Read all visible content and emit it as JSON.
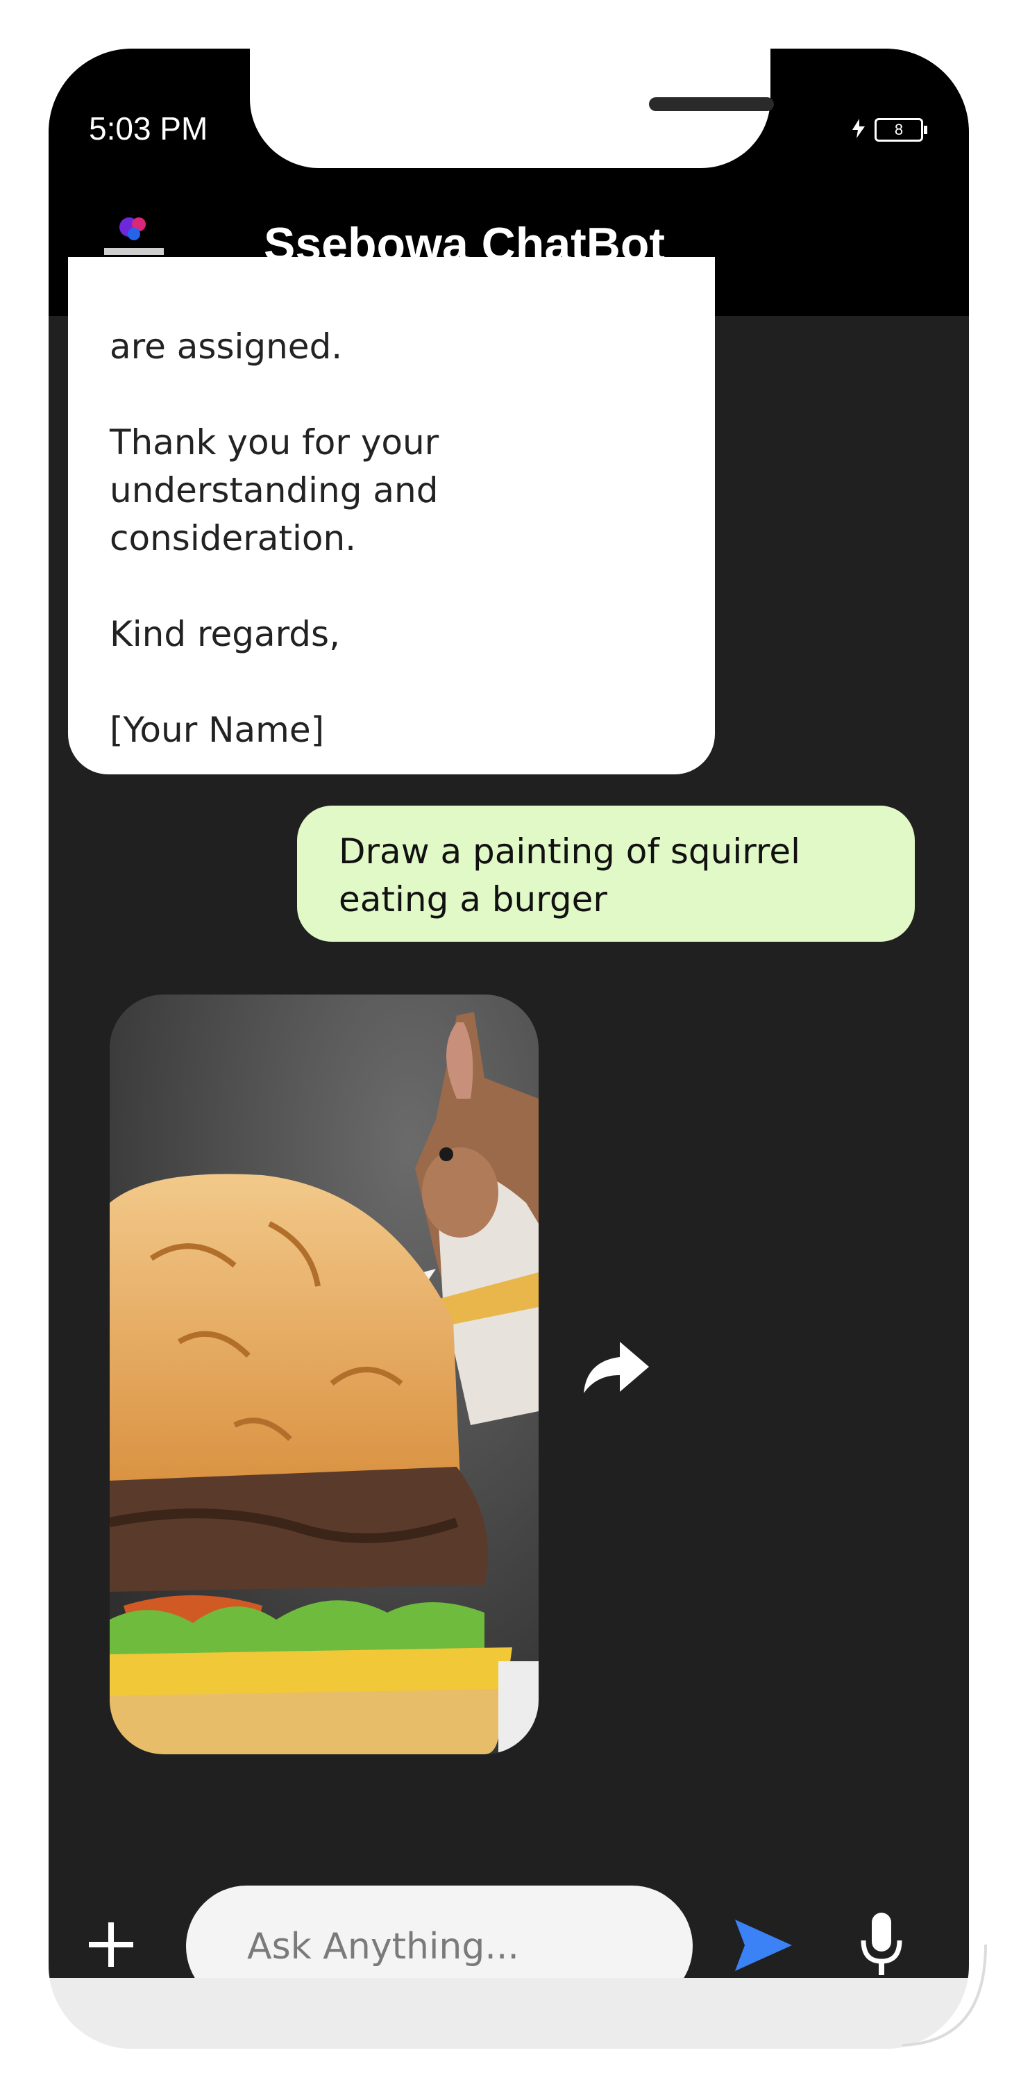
{
  "status_bar": {
    "time": "5:03 PM",
    "battery_level": "8"
  },
  "header": {
    "title": "Ssebowa ChatBot",
    "logo_icon": "ssebowa-logo-icon"
  },
  "messages": {
    "bot_paragraphs": [
      "are assigned.",
      "Thank you for your understanding and consideration.",
      "Kind regards,",
      "[Your Name]"
    ],
    "user_prompt": "Draw a painting of squirrel eating a burger",
    "generated_image": "squirrel eating a burger painting"
  },
  "input_bar": {
    "placeholder": "Ask Anything...",
    "value": ""
  },
  "colors": {
    "screen_bg": "#202020",
    "header_bg": "#000000",
    "bot_bubble": "#ffffff",
    "user_bubble": "#e1f9c7",
    "send_accent": "#3b82f6"
  },
  "icons": [
    "charge-icon",
    "battery-icon",
    "ssebowa-logo-icon",
    "share-icon",
    "plus-icon",
    "send-icon",
    "microphone-icon"
  ]
}
